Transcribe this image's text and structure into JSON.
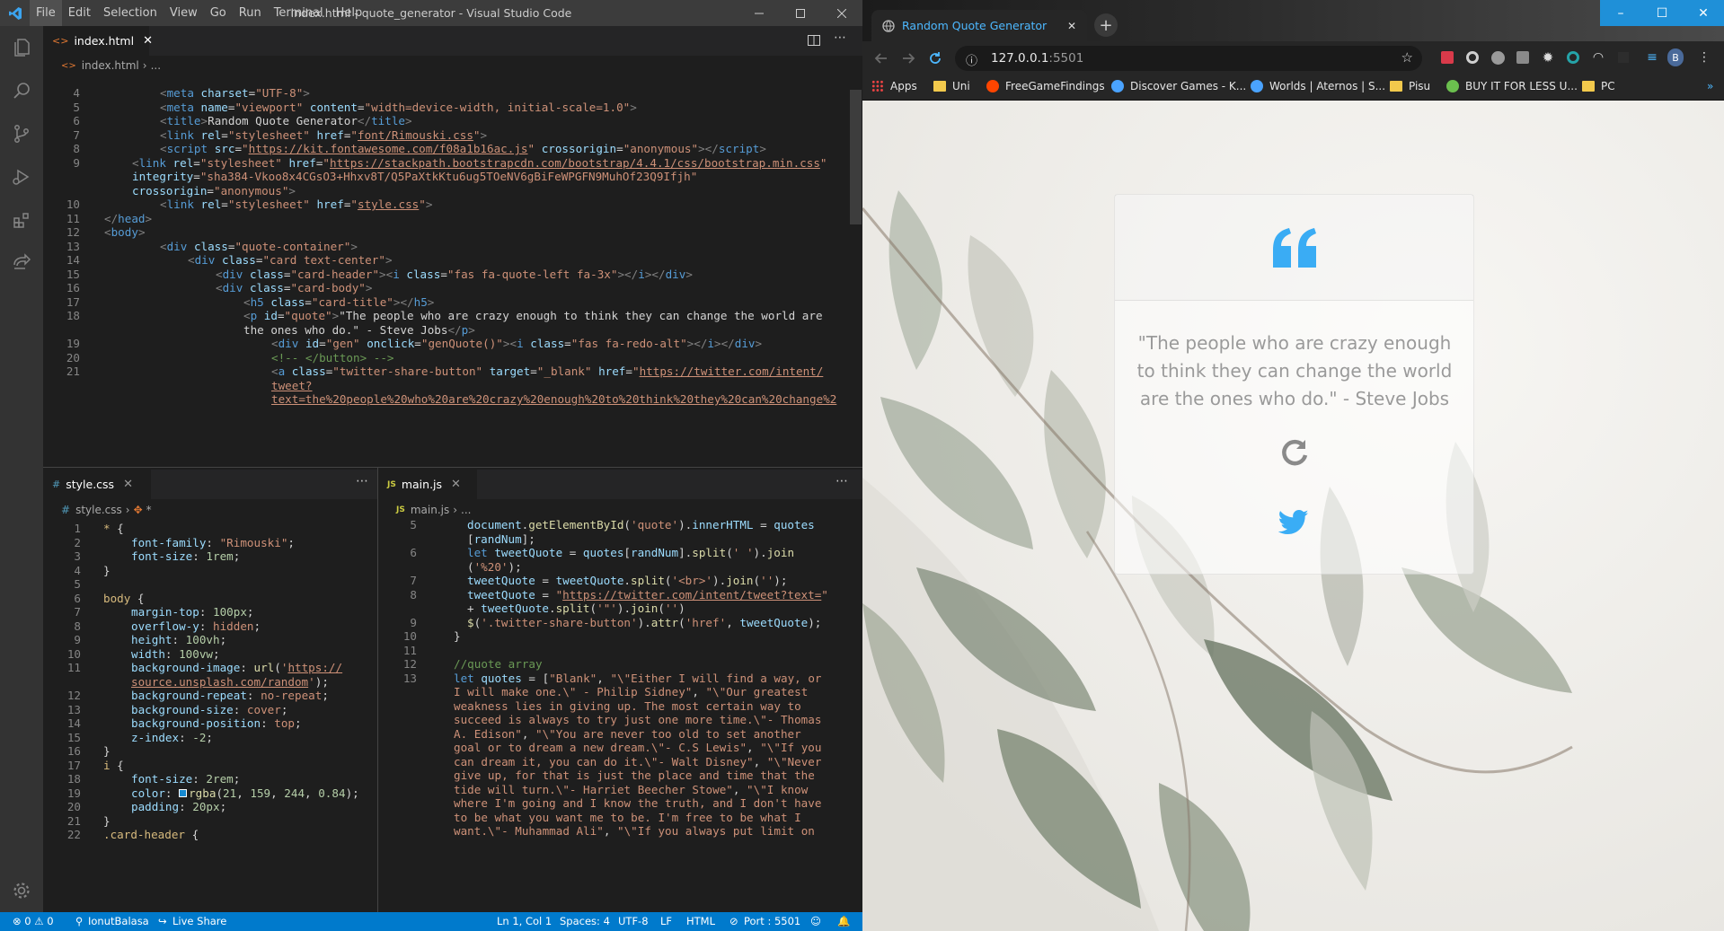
{
  "vscode": {
    "menu": [
      "File",
      "Edit",
      "Selection",
      "View",
      "Go",
      "Run",
      "Terminal",
      "Help"
    ],
    "window_title": "index.html - quote_generator - Visual Studio Code",
    "top_tab": {
      "label": "index.html",
      "icon": "html-icon"
    },
    "top_breadcrumb": {
      "file": "index.html",
      "rest": "..."
    },
    "bottom_left_tab": {
      "label": "style.css",
      "icon": "css-icon"
    },
    "bottom_left_breadcrumb": {
      "file": "style.css",
      "rest": "*"
    },
    "bottom_right_tab": {
      "label": "main.js",
      "icon": "js-icon",
      "icon_text": "JS"
    },
    "bottom_right_breadcrumb": {
      "file": "main.js",
      "rest": "..."
    },
    "status": {
      "problems": "⊗ 0 ⚠ 0",
      "user": "IonutBalasa",
      "live_share": "Live Share",
      "position": "Ln 1, Col 1",
      "spaces": "Spaces: 4",
      "encoding": "UTF-8",
      "eol": "LF",
      "language": "HTML",
      "port": "Port : 5501"
    },
    "html_lines": [
      {
        "n": "4",
        "indent": 2,
        "html": "<span class='c-br'>&lt;</span><span class='c-tag'>meta</span> <span class='c-attr'>charset</span>=<span class='c-str'>\"UTF-8\"</span><span class='c-br'>&gt;</span>"
      },
      {
        "n": "5",
        "indent": 2,
        "html": "<span class='c-br'>&lt;</span><span class='c-tag'>meta</span> <span class='c-attr'>name</span>=<span class='c-str'>\"viewport\"</span> <span class='c-attr'>content</span>=<span class='c-str'>\"width=device-width, initial-scale=1.0\"</span><span class='c-br'>&gt;</span>"
      },
      {
        "n": "6",
        "indent": 2,
        "html": "<span class='c-br'>&lt;</span><span class='c-tag'>title</span><span class='c-br'>&gt;</span>Random Quote Generator<span class='c-br'>&lt;/</span><span class='c-tag'>title</span><span class='c-br'>&gt;</span>"
      },
      {
        "n": "7",
        "indent": 2,
        "html": "<span class='c-br'>&lt;</span><span class='c-tag'>link</span> <span class='c-attr'>rel</span>=<span class='c-str'>\"stylesheet\"</span> <span class='c-attr'>href</span>=<span class='c-str'>\"<span class='c-url'>font/Rimouski.css</span>\"</span><span class='c-br'>&gt;</span>"
      },
      {
        "n": "8",
        "indent": 2,
        "html": "<span class='c-br'>&lt;</span><span class='c-tag'>script</span> <span class='c-attr'>src</span>=<span class='c-str'>\"<span class='c-url'>https://kit.fontawesome.com/f08a1b16ac.js</span>\"</span> <span class='c-attr'>crossorigin</span>=<span class='c-str'>\"anonymous\"</span><span class='c-br'>&gt;&lt;/</span><span class='c-tag'>script</span><span class='c-br'>&gt;</span>"
      },
      {
        "n": "9",
        "indent": 1,
        "html": "<span class='c-br'>&lt;</span><span class='c-tag'>link</span> <span class='c-attr'>rel</span>=<span class='c-str'>\"stylesheet\"</span> <span class='c-attr'>href</span>=<span class='c-str'>\"<span class='c-url'>https://stackpath.bootstrapcdn.com/bootstrap/4.4.1/css/bootstrap.min.css</span>\"</span>"
      },
      {
        "n": "",
        "indent": 1,
        "html": "<span class='c-attr'>integrity</span>=<span class='c-str'>\"sha384-Vkoo8x4CGsO3+Hhxv8T/Q5PaXtkKtu6ug5TOeNV6gBiFeWPGFN9MuhOf23Q9Ifjh\"</span>"
      },
      {
        "n": "",
        "indent": 1,
        "html": "<span class='c-attr'>crossorigin</span>=<span class='c-str'>\"anonymous\"</span><span class='c-br'>&gt;</span>"
      },
      {
        "n": "10",
        "indent": 2,
        "html": "<span class='c-br'>&lt;</span><span class='c-tag'>link</span> <span class='c-attr'>rel</span>=<span class='c-str'>\"stylesheet\"</span> <span class='c-attr'>href</span>=<span class='c-str'>\"<span class='c-url'>style.css</span>\"</span><span class='c-br'>&gt;</span>"
      },
      {
        "n": "11",
        "indent": 0,
        "html": "<span class='c-br'>&lt;/</span><span class='c-tag'>head</span><span class='c-br'>&gt;</span>"
      },
      {
        "n": "12",
        "indent": 0,
        "html": "<span class='c-br'>&lt;</span><span class='c-tag'>body</span><span class='c-br'>&gt;</span>"
      },
      {
        "n": "13",
        "indent": 2,
        "html": "<span class='c-br'>&lt;</span><span class='c-tag'>div</span> <span class='c-attr'>class</span>=<span class='c-str'>\"quote-container\"</span><span class='c-br'>&gt;</span>"
      },
      {
        "n": "14",
        "indent": 3,
        "html": "<span class='c-br'>&lt;</span><span class='c-tag'>div</span> <span class='c-attr'>class</span>=<span class='c-str'>\"card text-center\"</span><span class='c-br'>&gt;</span>"
      },
      {
        "n": "15",
        "indent": 4,
        "html": "<span class='c-br'>&lt;</span><span class='c-tag'>div</span> <span class='c-attr'>class</span>=<span class='c-str'>\"card-header\"</span><span class='c-br'>&gt;&lt;</span><span class='c-tag'>i</span> <span class='c-attr'>class</span>=<span class='c-str'>\"fas fa-quote-left fa-3x\"</span><span class='c-br'>&gt;&lt;/</span><span class='c-tag'>i</span><span class='c-br'>&gt;&lt;/</span><span class='c-tag'>div</span><span class='c-br'>&gt;</span>"
      },
      {
        "n": "16",
        "indent": 4,
        "html": "<span class='c-br'>&lt;</span><span class='c-tag'>div</span> <span class='c-attr'>class</span>=<span class='c-str'>\"card-body\"</span><span class='c-br'>&gt;</span>"
      },
      {
        "n": "17",
        "indent": 5,
        "html": "<span class='c-br'>&lt;</span><span class='c-tag'>h5</span> <span class='c-attr'>class</span>=<span class='c-str'>\"card-title\"</span><span class='c-br'>&gt;&lt;/</span><span class='c-tag'>h5</span><span class='c-br'>&gt;</span>"
      },
      {
        "n": "18",
        "indent": 5,
        "html": "<span class='c-br'>&lt;</span><span class='c-tag'>p</span> <span class='c-attr'>id</span>=<span class='c-str'>\"quote\"</span><span class='c-br'>&gt;</span>\"The people who are crazy enough to think they can change the world are"
      },
      {
        "n": "",
        "indent": 5,
        "html": "the ones who do.\" - Steve Jobs<span class='c-br'>&lt;/</span><span class='c-tag'>p</span><span class='c-br'>&gt;</span>"
      },
      {
        "n": "19",
        "indent": 6,
        "html": "<span class='c-br'>&lt;</span><span class='c-tag'>div</span> <span class='c-attr'>id</span>=<span class='c-str'>\"gen\"</span> <span class='c-attr'>onclick</span>=<span class='c-str'>\"genQuote()\"</span><span class='c-br'>&gt;&lt;</span><span class='c-tag'>i</span> <span class='c-attr'>class</span>=<span class='c-str'>\"fas fa-redo-alt\"</span><span class='c-br'>&gt;&lt;/</span><span class='c-tag'>i</span><span class='c-br'>&gt;&lt;/</span><span class='c-tag'>div</span><span class='c-br'>&gt;</span>"
      },
      {
        "n": "20",
        "indent": 6,
        "html": "<span class='c-cmt'>&lt;!-- &lt;/button&gt; --&gt;</span>"
      },
      {
        "n": "21",
        "indent": 6,
        "html": "<span class='c-br'>&lt;</span><span class='c-tag'>a</span> <span class='c-attr'>class</span>=<span class='c-str'>\"twitter-share-button\"</span> <span class='c-attr'>target</span>=<span class='c-str'>\"_blank\"</span> <span class='c-attr'>href</span>=<span class='c-str'>\"<span class='c-url'>https://twitter.com/intent/</span></span>"
      },
      {
        "n": "",
        "indent": 6,
        "html": "<span class='c-url'>tweet?</span>"
      },
      {
        "n": "",
        "indent": 6,
        "html": "<span class='c-url'>text=the%20people%20who%20are%20crazy%20enough%20to%20think%20they%20can%20change%2</span>"
      }
    ],
    "css_lines": [
      {
        "n": "1",
        "indent": 0,
        "html": "<span class='c-sel'>*</span> {"
      },
      {
        "n": "2",
        "indent": 1,
        "html": "<span class='c-prop'>font-family</span>: <span class='c-str'>\"Rimouski\"</span>;"
      },
      {
        "n": "3",
        "indent": 1,
        "html": "<span class='c-prop'>font-size</span>: <span class='c-num'>1rem</span>;"
      },
      {
        "n": "4",
        "indent": 0,
        "html": "}"
      },
      {
        "n": "5",
        "indent": 0,
        "html": ""
      },
      {
        "n": "6",
        "indent": 0,
        "html": "<span class='c-sel'>body</span> {"
      },
      {
        "n": "7",
        "indent": 1,
        "html": "<span class='c-prop'>margin-top</span>: <span class='c-num'>100px</span>;"
      },
      {
        "n": "8",
        "indent": 1,
        "html": "<span class='c-prop'>overflow-y</span>: <span class='c-str'>hidden</span>;"
      },
      {
        "n": "9",
        "indent": 1,
        "html": "<span class='c-prop'>height</span>: <span class='c-num'>100vh</span>;"
      },
      {
        "n": "10",
        "indent": 1,
        "html": "<span class='c-prop'>width</span>: <span class='c-num'>100vw</span>;"
      },
      {
        "n": "11",
        "indent": 1,
        "html": "<span class='c-prop'>background-image</span>: <span class='c-fn'>url</span>(<span class='c-str'>'<span class='c-url'>https://</span></span>"
      },
      {
        "n": "",
        "indent": 1,
        "html": "<span class='c-str'><span class='c-url'>source.unsplash.com/random</span>'</span>);"
      },
      {
        "n": "12",
        "indent": 1,
        "html": "<span class='c-prop'>background-repeat</span>: <span class='c-str'>no-repeat</span>;"
      },
      {
        "n": "13",
        "indent": 1,
        "html": "<span class='c-prop'>background-size</span>: <span class='c-str'>cover</span>;"
      },
      {
        "n": "14",
        "indent": 1,
        "html": "<span class='c-prop'>background-position</span>: <span class='c-str'>top</span>;"
      },
      {
        "n": "15",
        "indent": 1,
        "html": "<span class='c-prop'>z-index</span>: <span class='c-num'>-2</span>;"
      },
      {
        "n": "16",
        "indent": 0,
        "html": "}"
      },
      {
        "n": "17",
        "indent": 0,
        "html": "<span class='c-sel'>i</span> {"
      },
      {
        "n": "18",
        "indent": 1,
        "html": "<span class='c-prop'>font-size</span>: <span class='c-num'>2rem</span>;"
      },
      {
        "n": "19",
        "indent": 1,
        "html": "<span class='c-prop'>color</span>: <span style='display:inline-block;width:9px;height:9px;background:rgba(21,159,244,0.84);border:1px solid #fff;margin-right:2px;'></span><span class='c-fn'>rgba</span>(<span class='c-num'>21</span>, <span class='c-num'>159</span>, <span class='c-num'>244</span>, <span class='c-num'>0.84</span>);"
      },
      {
        "n": "20",
        "indent": 1,
        "html": "<span class='c-prop'>padding</span>: <span class='c-num'>20px</span>;"
      },
      {
        "n": "21",
        "indent": 0,
        "html": "}"
      },
      {
        "n": "22",
        "indent": 0,
        "html": "<span class='c-sel'>.card-header</span> {"
      }
    ],
    "js_lines": [
      {
        "n": "5",
        "indent": 1,
        "html": "<span class='c-var'>document</span>.<span class='c-fn'>getElementById</span>(<span class='c-str'>'quote'</span>).<span class='c-var'>innerHTML</span> = <span class='c-var'>quotes</span>"
      },
      {
        "n": "",
        "indent": 1,
        "html": "[<span class='c-var'>randNum</span>];"
      },
      {
        "n": "6",
        "indent": 1,
        "html": "<span class='c-kw'>let</span> <span class='c-var'>tweetQuote</span> = <span class='c-var'>quotes</span>[<span class='c-var'>randNum</span>].<span class='c-fn'>split</span>(<span class='c-str'>' '</span>).<span class='c-fn'>join</span>"
      },
      {
        "n": "",
        "indent": 1,
        "html": "(<span class='c-str'>'%20'</span>);"
      },
      {
        "n": "7",
        "indent": 1,
        "html": "<span class='c-var'>tweetQuote</span> = <span class='c-var'>tweetQuote</span>.<span class='c-fn'>split</span>(<span class='c-str'>'&lt;br&gt;'</span>).<span class='c-fn'>join</span>(<span class='c-str'>''</span>);"
      },
      {
        "n": "8",
        "indent": 1,
        "html": "<span class='c-var'>tweetQuote</span> = <span class='c-str'>\"<span class='c-url'>https://twitter.com/intent/tweet?text=</span>\"</span>"
      },
      {
        "n": "",
        "indent": 1,
        "html": "+ <span class='c-var'>tweetQuote</span>.<span class='c-fn'>split</span>(<span class='c-str'>'\"'</span>).<span class='c-fn'>join</span>(<span class='c-str'>''</span>)"
      },
      {
        "n": "9",
        "indent": 1,
        "html": "<span class='c-fn'>$</span>(<span class='c-str'>'.twitter-share-button'</span>).<span class='c-fn'>attr</span>(<span class='c-str'>'href'</span>, <span class='c-var'>tweetQuote</span>);"
      },
      {
        "n": "10",
        "indent": 0,
        "html": "}"
      },
      {
        "n": "11",
        "indent": 0,
        "html": ""
      },
      {
        "n": "12",
        "indent": 0,
        "html": "<span class='c-cmt'>//quote array</span>"
      },
      {
        "n": "13",
        "indent": 0,
        "html": "<span class='c-kw'>let</span> <span class='c-var'>quotes</span> = [<span class='c-str'>\"Blank\"</span>, <span class='c-str'>\"\\\"Either I will find a way, or</span>"
      },
      {
        "n": "",
        "indent": 0,
        "html": "<span class='c-str'>I will make one.\\\" - Philip Sidney\"</span>, <span class='c-str'>\"\\\"Our greatest</span>"
      },
      {
        "n": "",
        "indent": 0,
        "html": "<span class='c-str'>weakness lies in giving up. The most certain way to</span>"
      },
      {
        "n": "",
        "indent": 0,
        "html": "<span class='c-str'>succeed is always to try just one more time.\\\"- Thomas</span>"
      },
      {
        "n": "",
        "indent": 0,
        "html": "<span class='c-str'>A. Edison\"</span>, <span class='c-str'>\"\\\"You are never too old to set another</span>"
      },
      {
        "n": "",
        "indent": 0,
        "html": "<span class='c-str'>goal or to dream a new dream.\\\"- C.S Lewis\"</span>, <span class='c-str'>\"\\\"If you</span>"
      },
      {
        "n": "",
        "indent": 0,
        "html": "<span class='c-str'>can dream it, you can do it.\\\"- Walt Disney\"</span>, <span class='c-str'>\"\\\"Never</span>"
      },
      {
        "n": "",
        "indent": 0,
        "html": "<span class='c-str'>give up, for that is just the place and time that the</span>"
      },
      {
        "n": "",
        "indent": 0,
        "html": "<span class='c-str'>tide will turn.\\\"- Harriet Beecher Stowe\"</span>, <span class='c-str'>\"\\\"I know</span>"
      },
      {
        "n": "",
        "indent": 0,
        "html": "<span class='c-str'>where I'm going and I know the truth, and I don't have</span>"
      },
      {
        "n": "",
        "indent": 0,
        "html": "<span class='c-str'>to be what you want me to be. I'm free to be what I</span>"
      },
      {
        "n": "",
        "indent": 0,
        "html": "<span class='c-str'>want.\\\"- Muhammad Ali\"</span>, <span class='c-str'>\"\\\"If you always put limit on</span>"
      }
    ]
  },
  "chrome": {
    "tab_title": "Random Quote Generator",
    "url_host": "127.0.0.1",
    "url_port": ":5501",
    "bookmarks": [
      {
        "label": "Apps",
        "icon": "apps-grid-icon",
        "color": "#e44"
      },
      {
        "label": "Uni",
        "icon": "folder-icon",
        "color": "#f2c94c"
      },
      {
        "label": "FreeGameFindings",
        "icon": "reddit-icon",
        "color": "#ff4500"
      },
      {
        "label": "Discover Games - K...",
        "icon": "steam-icon",
        "color": "#4aa3ff"
      },
      {
        "label": "Worlds | Aternos | S...",
        "icon": "aternos-icon",
        "color": "#4aa3ff"
      },
      {
        "label": "Pisu",
        "icon": "folder-icon",
        "color": "#f2c94c"
      },
      {
        "label": "BUY IT FOR LESS U...",
        "icon": "bifl-icon",
        "color": "#6bbf4e"
      },
      {
        "label": "PC",
        "icon": "folder-icon",
        "color": "#f2c94c"
      }
    ],
    "profile_initial": "B",
    "page": {
      "quote_text": "\"The people who are crazy enough to think they can change the world are the ones who do.\" - Steve Jobs",
      "accent_color": "#159ff4"
    }
  }
}
